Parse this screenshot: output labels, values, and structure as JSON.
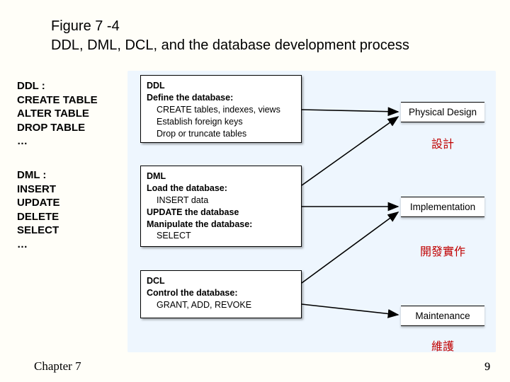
{
  "title_line1": "Figure 7 -4",
  "title_line2": "DDL, DML, DCL, and the database development process",
  "notes": {
    "ddl": "DDL :\nCREATE TABLE\nALTER TABLE\nDROP TABLE\n…",
    "dml": "DML :\nINSERT\nUPDATE\nDELETE\nSELECT\n…"
  },
  "boxes": {
    "ddl": {
      "hdr": "DDL",
      "sub": "Define the database:",
      "items": [
        "CREATE tables, indexes, views",
        "Establish foreign keys",
        "Drop or truncate tables"
      ]
    },
    "dml": {
      "hdr": "DML",
      "sub1": "Load the database:",
      "item1": "INSERT data",
      "sub2": "UPDATE the database",
      "sub3": "Manipulate the database:",
      "item3": "SELECT"
    },
    "dcl": {
      "hdr": "DCL",
      "sub": "Control the database:",
      "items": [
        "GRANT, ADD, REVOKE"
      ]
    }
  },
  "phases": {
    "pd": "Physical Design",
    "impl": "Implementation",
    "maint": "Maintenance"
  },
  "captions": {
    "pd": "設計",
    "impl": "開發實作",
    "maint": "維護"
  },
  "footer": {
    "chapter": "Chapter 7",
    "page": "9"
  },
  "chart_data": {
    "type": "table",
    "title": "DDL, DML, DCL and the database development process",
    "mappings": [
      {
        "source": "DDL",
        "targets": [
          "Physical Design"
        ]
      },
      {
        "source": "DML",
        "targets": [
          "Physical Design",
          "Implementation"
        ]
      },
      {
        "source": "DCL",
        "targets": [
          "Implementation",
          "Maintenance"
        ]
      }
    ]
  }
}
